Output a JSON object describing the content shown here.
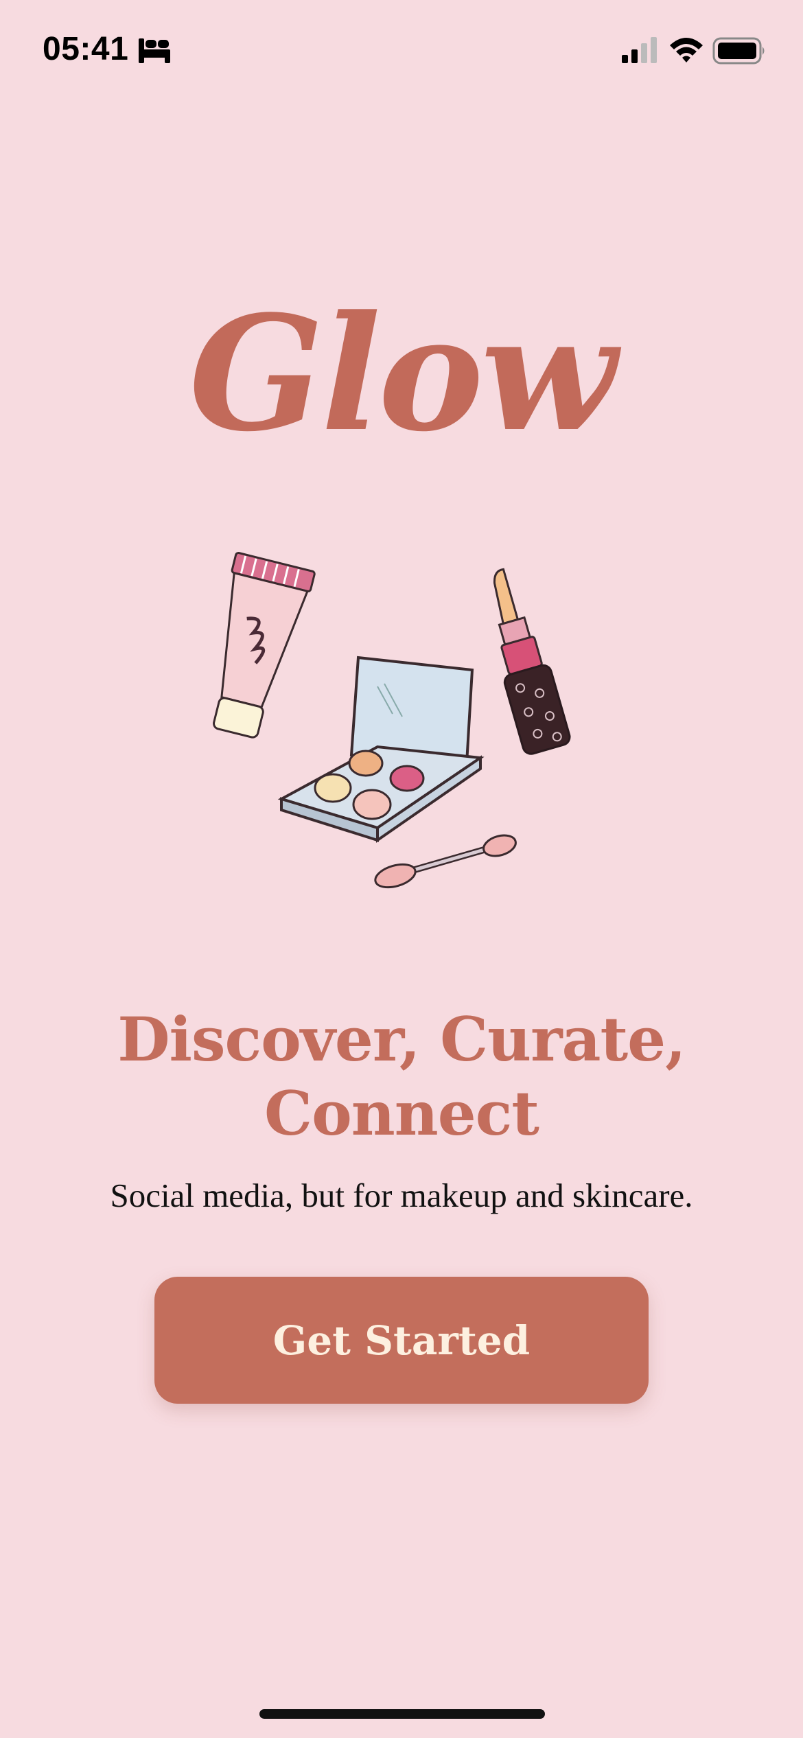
{
  "status_bar": {
    "time": "05:41",
    "icons": [
      "sleep-mode-icon",
      "cellular-signal-icon",
      "wifi-icon",
      "battery-icon"
    ]
  },
  "app": {
    "logo": "Glow",
    "illustration_icons": [
      "cream-tube-icon",
      "eyeshadow-palette-icon",
      "lipstick-icon",
      "applicator-brush-icon"
    ]
  },
  "onboarding": {
    "headline_line1": "Discover, Curate,",
    "headline_line2": "Connect",
    "subtitle": "Social media, but for makeup and skincare.",
    "cta_label": "Get Started"
  },
  "colors": {
    "background": "#f7dbe0",
    "brand": "#c36e5c",
    "button_text": "#fdf0e0"
  }
}
